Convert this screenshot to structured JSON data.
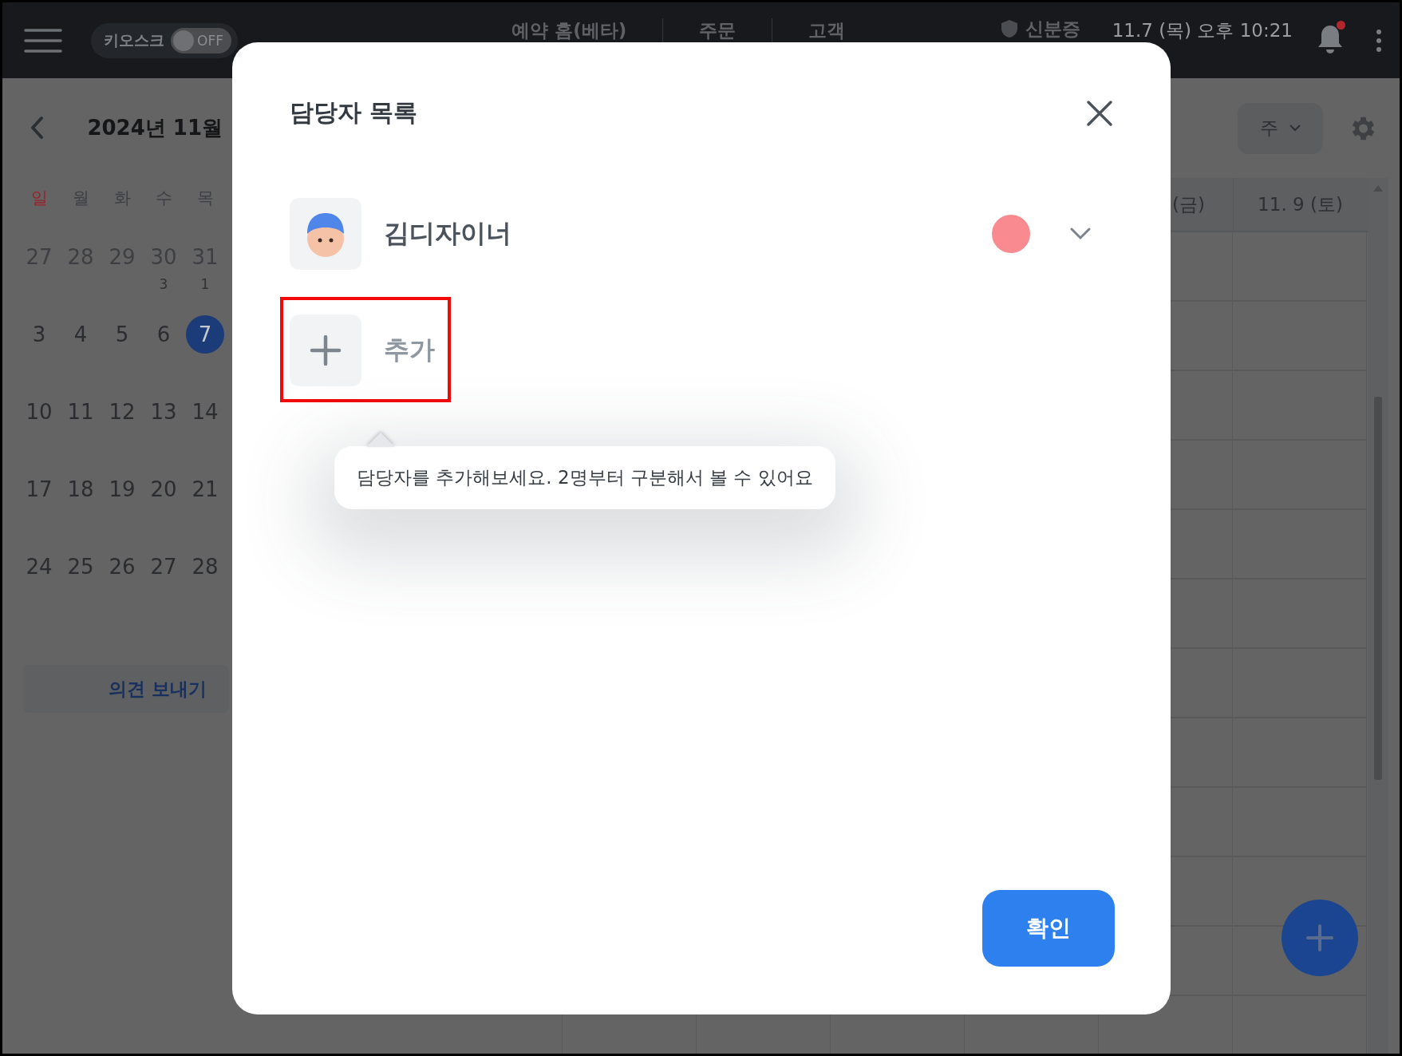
{
  "top_bar": {
    "kiosk": {
      "label": "키오스크",
      "on": false,
      "state_label": "OFF"
    },
    "nav": [
      {
        "label": "예약 홈(베타)"
      },
      {
        "label": "주문"
      },
      {
        "label": "고객"
      }
    ],
    "id_status": "신분증",
    "datetime": "11.7 (목) 오후 10:21",
    "notification_dot": true
  },
  "calendar": {
    "title": "2024년 11월",
    "weekdays": [
      {
        "label": "일",
        "kind": "sunday"
      },
      {
        "label": "월",
        "kind": "weekday"
      },
      {
        "label": "화",
        "kind": "weekday"
      },
      {
        "label": "수",
        "kind": "weekday"
      },
      {
        "label": "목",
        "kind": "weekday"
      }
    ],
    "weeks": [
      [
        {
          "day": "27",
          "muted": true,
          "selected": false
        },
        {
          "day": "28",
          "muted": true,
          "selected": false
        },
        {
          "day": "29",
          "muted": true,
          "selected": false
        },
        {
          "day": "30",
          "muted": true,
          "selected": false,
          "count": "3"
        },
        {
          "day": "31",
          "muted": true,
          "selected": false,
          "count": "1"
        }
      ],
      [
        {
          "day": "3",
          "muted": false,
          "selected": false
        },
        {
          "day": "4",
          "muted": false,
          "selected": false
        },
        {
          "day": "5",
          "muted": false,
          "selected": false
        },
        {
          "day": "6",
          "muted": false,
          "selected": false
        },
        {
          "day": "7",
          "muted": false,
          "selected": true
        }
      ],
      [
        {
          "day": "10",
          "muted": false,
          "selected": false
        },
        {
          "day": "11",
          "muted": false,
          "selected": false
        },
        {
          "day": "12",
          "muted": false,
          "selected": false
        },
        {
          "day": "13",
          "muted": false,
          "selected": false
        },
        {
          "day": "14",
          "muted": false,
          "selected": false
        }
      ],
      [
        {
          "day": "17",
          "muted": false,
          "selected": false
        },
        {
          "day": "18",
          "muted": false,
          "selected": false
        },
        {
          "day": "19",
          "muted": false,
          "selected": false
        },
        {
          "day": "20",
          "muted": false,
          "selected": false
        },
        {
          "day": "21",
          "muted": false,
          "selected": false
        }
      ],
      [
        {
          "day": "24",
          "muted": false,
          "selected": false
        },
        {
          "day": "25",
          "muted": false,
          "selected": false
        },
        {
          "day": "26",
          "muted": false,
          "selected": false
        },
        {
          "day": "27",
          "muted": false,
          "selected": false
        },
        {
          "day": "28",
          "muted": false,
          "selected": false
        }
      ]
    ],
    "feedback_button": "의견 보내기"
  },
  "week_view": {
    "view_select": "주",
    "columns": [
      "(금)",
      "11. 9 (토)"
    ]
  },
  "modal": {
    "title": "담당자 목록",
    "members": [
      {
        "name": "김디자이너",
        "color": "#f98a8f"
      }
    ],
    "add_label": "추가",
    "tooltip": "담당자를 추가해보세요. 2명부터 구분해서 볼 수 있어요",
    "confirm": "확인"
  }
}
